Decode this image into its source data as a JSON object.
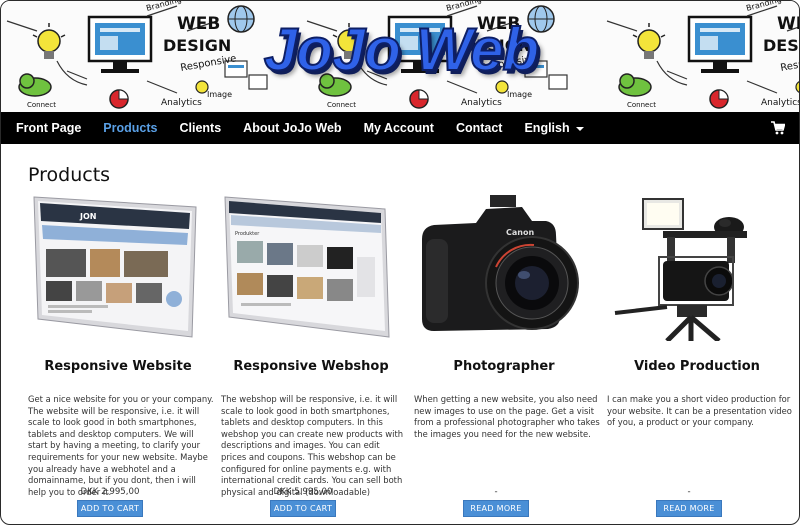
{
  "banner": {
    "logo_text": "JoJo Web",
    "sketch_words": [
      "WEB",
      "DESIGN",
      "Responsive",
      "Analytics",
      "Connect",
      "Image",
      "Branding"
    ]
  },
  "nav": {
    "items": [
      {
        "label": "Front Page",
        "active": false
      },
      {
        "label": "Products",
        "active": true
      },
      {
        "label": "Clients",
        "active": false
      },
      {
        "label": "About JoJo Web",
        "active": false
      },
      {
        "label": "My Account",
        "active": false
      },
      {
        "label": "Contact",
        "active": false
      },
      {
        "label": "English",
        "active": false
      }
    ],
    "active_color": "#5aa0e6",
    "cart_icon": "cart-icon"
  },
  "page": {
    "title": "Products"
  },
  "products": [
    {
      "name": "Responsive Website",
      "description": "Get a nice website for you or your company. The website will be responsive, i.e. it will scale to look good in both smartphones, tablets and desktop computers. We will start by having a meeting, to clarify your requirements for your new website. Maybe you already have a webhotel and a domainname, but if you dont, then i will help you to order it.",
      "price": "DKK 2.995,00",
      "button": "ADD TO CART"
    },
    {
      "name": "Responsive Webshop",
      "description": "The webshop will be responsive, i.e. it will scale to look good in both smartphones, tablets and desktop computers. In this webshop you can create new products with descriptions and images. You can edit prices and coupons. This webshop can be configured for online payments e.g. with international credit cards. You can sell both physical and digital (downloadable)",
      "price": "DKK 5.995,00",
      "button": "ADD TO CART"
    },
    {
      "name": "Photographer",
      "description": "When getting a new website, you also need new images to use on the page. Get a visit from a professional photographer who takes the images you need for the new website.",
      "price": "-",
      "button": "READ MORE",
      "camera_brand": "Canon"
    },
    {
      "name": "Video Production",
      "description": "I can make you a short video production for your website. It can be a presentation video of you, a product or your company.",
      "price": "-",
      "button": "READ MORE"
    }
  ],
  "colors": {
    "nav_bg": "#000000",
    "button": "#4a8fd6",
    "logo": "#2f62e8"
  }
}
